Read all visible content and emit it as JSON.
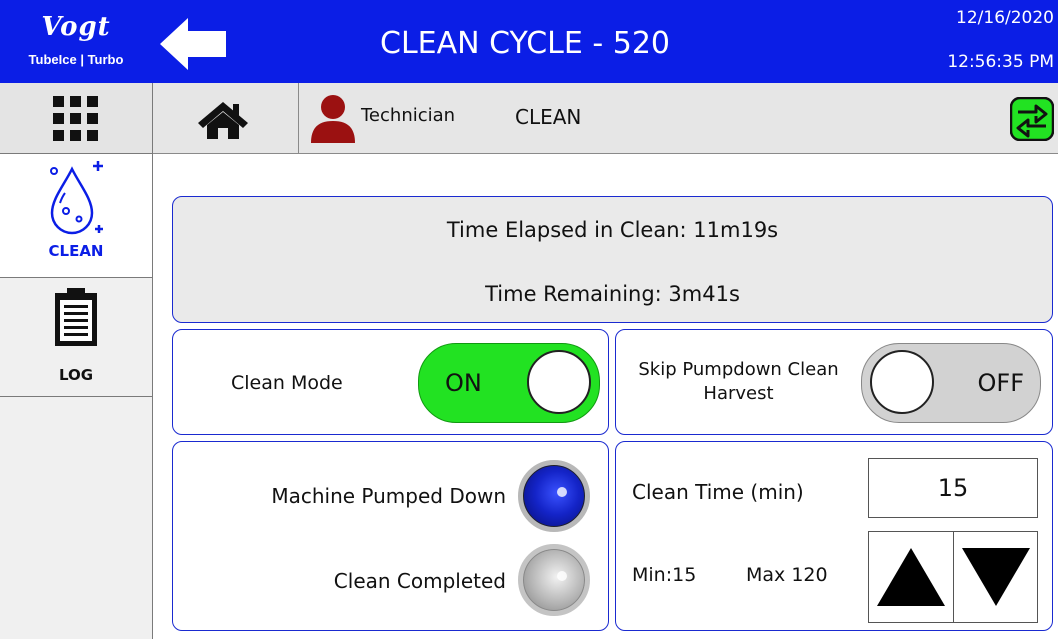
{
  "header": {
    "logo_brand": "Vogt",
    "logo_tag": "TubeIce | Turbo",
    "title": "CLEAN CYCLE - 520",
    "date": "12/16/2020",
    "time": "12:56:35 PM"
  },
  "leftnav": {
    "items": [
      {
        "label": "CLEAN",
        "icon": "water-drop-icon"
      },
      {
        "label": "LOG",
        "icon": "clipboard-icon"
      }
    ]
  },
  "subbar": {
    "user": "Technician",
    "mode": "CLEAN"
  },
  "timing": {
    "elapsed": "Time Elapsed in Clean: 11m19s",
    "remaining": "Time Remaining: 3m41s"
  },
  "clean_mode": {
    "label": "Clean Mode",
    "state": "ON"
  },
  "skip_pumpdown": {
    "label_1": "Skip Pumpdown Clean",
    "label_2": "Harvest",
    "state": "OFF"
  },
  "status": {
    "pumped_down_label": "Machine Pumped Down",
    "completed_label": "Clean Completed"
  },
  "clean_time": {
    "label": "Clean Time (min)",
    "value": "15",
    "min": "Min:15",
    "max": "Max 120"
  },
  "colors": {
    "header_blue": "#0b1ee6",
    "toggle_on": "#22e222",
    "toggle_off": "#d2d2d2",
    "user_icon": "#9b1111",
    "swap_icon": "#22e222"
  }
}
